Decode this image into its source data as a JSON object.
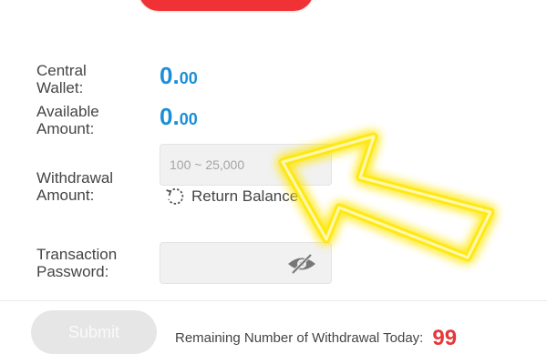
{
  "wallet": {
    "central_label_line1": "Central",
    "central_label_line2": "Wallet:",
    "central_int": "0.",
    "central_dec": "00",
    "available_label_line1": "Available",
    "available_label_line2": "Amount:",
    "available_int": "0.",
    "available_dec": "00"
  },
  "withdrawal": {
    "label_line1": "Withdrawal",
    "label_line2": "Amount:",
    "placeholder": "100 ~ 25,000",
    "return_balance": "Return Balance"
  },
  "password": {
    "label_line1": "Transaction",
    "label_line2": "Password:"
  },
  "footer": {
    "submit_label": "Submit",
    "remaining_label": "Remaining Number of Withdrawal Today:",
    "remaining_count": "99"
  },
  "colors": {
    "accent_blue": "#1b8ed8",
    "red": "#f03236",
    "arrow_yellow": "#ffe600"
  },
  "icons": {
    "refresh": "refresh-icon",
    "eye": "eye-slash-icon",
    "pointer": "arrow-icon"
  }
}
